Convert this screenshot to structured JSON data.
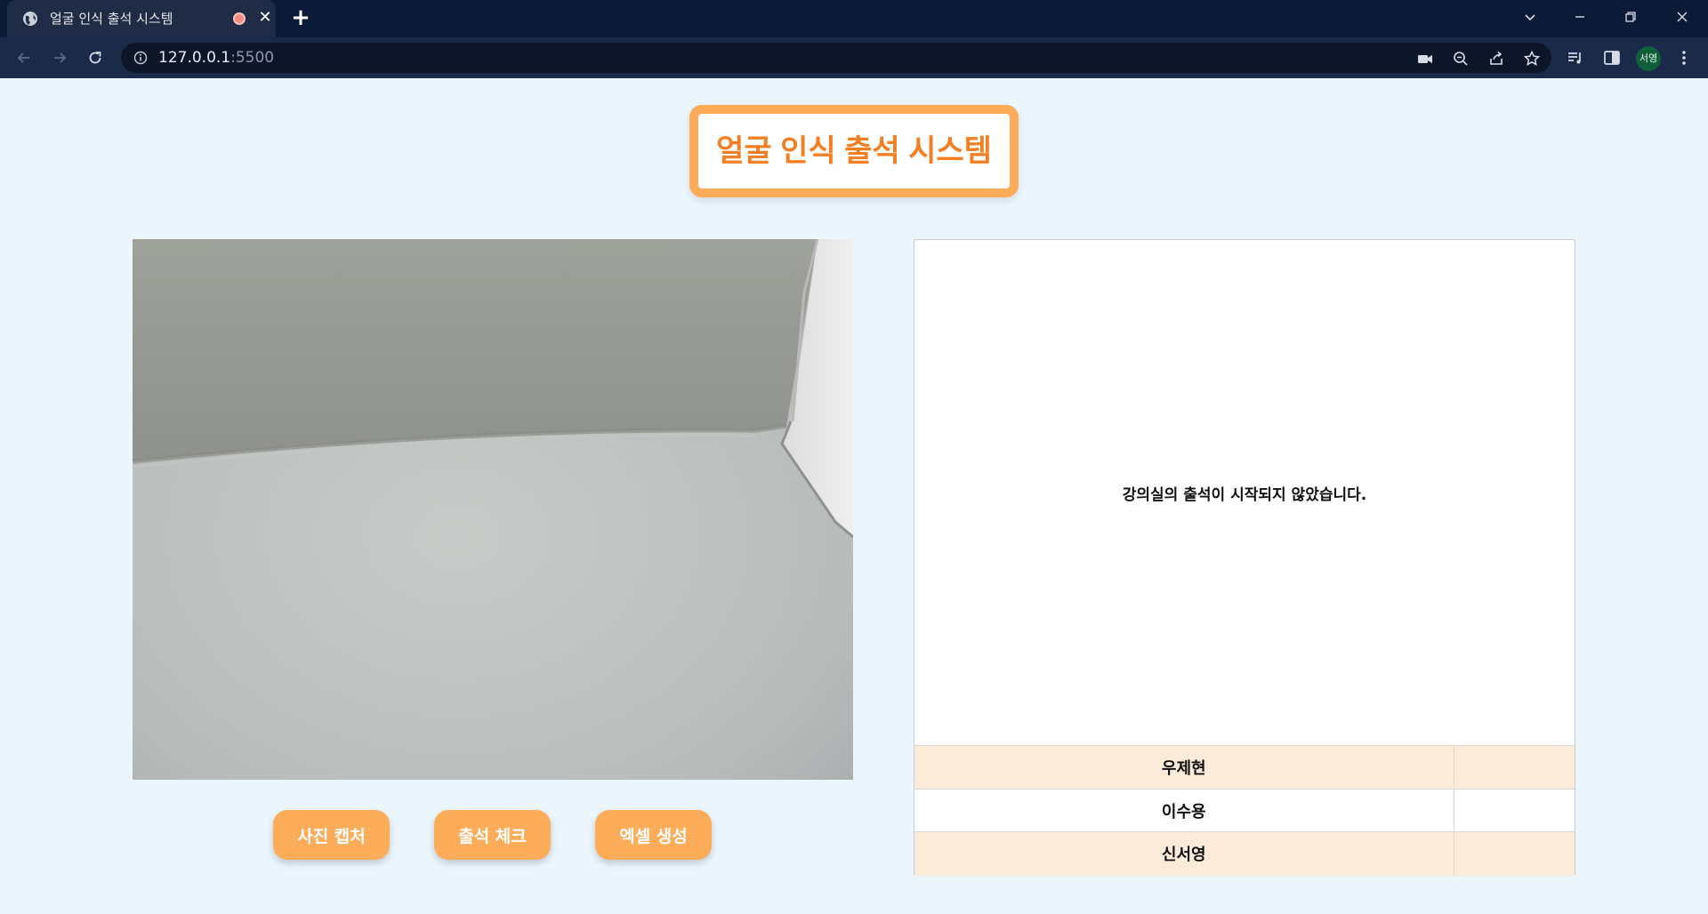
{
  "browser": {
    "tab_title": "얼굴 인식 출석 시스템",
    "url_host": "127.0.0.1",
    "url_port": ":5500",
    "profile_label": "서영"
  },
  "page": {
    "title": "얼굴 인식 출석 시스템",
    "buttons": {
      "capture": "사진 캡처",
      "attendance": "출석 체크",
      "excel": "엑셀 생성"
    },
    "status_message": "강의실의 출석이 시작되지 않았습니다.",
    "students": [
      {
        "name": "우제현",
        "status": ""
      },
      {
        "name": "이수용",
        "status": ""
      },
      {
        "name": "신서영",
        "status": ""
      }
    ]
  },
  "colors": {
    "accent_orange": "#fdac5a",
    "title_text": "#f37f22",
    "row_highlight": "#fdebd9",
    "page_background": "#eaf5fc"
  }
}
